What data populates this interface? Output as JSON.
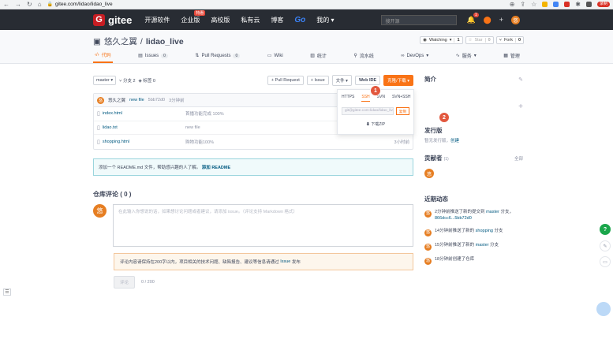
{
  "browser": {
    "url": "gitee.com/lidao/lidao_live",
    "record_label": "录制"
  },
  "topnav": {
    "logo": "gitee",
    "items": [
      "开源软件",
      "企业版",
      "高校版",
      "私有云",
      "博客"
    ],
    "hot_badge": "特惠",
    "go": "Go",
    "mine": "我的",
    "search_placeholder": "搜开源",
    "notif_count": "1",
    "avatar": "悠"
  },
  "repo": {
    "owner": "悠久之翼",
    "name": "lidao_live",
    "watching_label": "Watching",
    "watching_count": "1",
    "star_label": "Star",
    "star_count": "0",
    "fork_label": "Fork",
    "fork_count": "0"
  },
  "tabs": [
    {
      "label": "代码",
      "count": ""
    },
    {
      "label": "Issues",
      "count": "0"
    },
    {
      "label": "Pull Requests",
      "count": "0"
    },
    {
      "label": "Wiki",
      "count": ""
    },
    {
      "label": "统计",
      "count": ""
    },
    {
      "label": "流水线",
      "count": ""
    },
    {
      "label": "DevOps",
      "count": ""
    },
    {
      "label": "服务",
      "count": ""
    },
    {
      "label": "管理",
      "count": ""
    }
  ],
  "toolbar": {
    "branch": "master",
    "branches": "分支 2",
    "tags": "标签 0",
    "pull_request": "+ Pull Request",
    "issue": "+ Issue",
    "file": "文件",
    "web_ide": "Web IDE",
    "clone": "克隆/下载"
  },
  "commit": {
    "avatar": "悠",
    "author": "悠久之翼",
    "message": "new file",
    "hash": "5bb72d0",
    "time": "3分钟前"
  },
  "files": [
    {
      "name": "index.html",
      "message": "首播功能完成 100%",
      "time": ""
    },
    {
      "name": "lidao.txt",
      "message": "new file",
      "time": ""
    },
    {
      "name": "shopping.html",
      "message": "购物功能100%",
      "time": "3小时前"
    }
  ],
  "clone_dropdown": {
    "tabs": [
      "HTTPS",
      "SSH",
      "SVN",
      "SVN+SSH"
    ],
    "url": "git@gitee.com:lidao/lidao_live.git",
    "copy": "复制",
    "zip": "下载ZIP"
  },
  "readme": {
    "text": "添加一个 README.md 文件，帮助感兴趣的人了解。",
    "link": "添加 README"
  },
  "comments": {
    "title": "仓库评论 ( 0 )",
    "avatar": "悠",
    "placeholder": "在此输入你想说的话，如果想讨论问题或者建议，请添加 issue。（评论支持 Markdown 格式）",
    "notice": "评论内容请保持在200字以内，项目相关的技术问题、缺陷报告、建议等信息请通过",
    "notice_link": "Issue",
    "notice_end": "发布",
    "submit": "评论",
    "counter": "0 / 200"
  },
  "sidebar": {
    "intro_title": "简介",
    "release_title": "发行版",
    "release_desc": "暂无发行版，",
    "release_create": "创建",
    "contrib_title": "贡献者",
    "contrib_count": "(1)",
    "contrib_all": "全部",
    "contrib_avatar": "悠",
    "recent_title": "近期动态",
    "activities": [
      {
        "pre": "2分钟前推送了新的提交到",
        "link": "master",
        "post": "分支，",
        "link2": "866dcc6...5bb72d0"
      },
      {
        "pre": "14分钟前推送了新的",
        "link": "shopping",
        "post": "分支",
        "link2": ""
      },
      {
        "pre": "15分钟前推送了新的",
        "link": "master",
        "post": "分支",
        "link2": ""
      },
      {
        "pre": "18分钟前创建了仓库",
        "link": "",
        "post": "",
        "link2": ""
      }
    ]
  },
  "badges": {
    "one": "1",
    "two": "2"
  },
  "float": {
    "help": "?"
  }
}
